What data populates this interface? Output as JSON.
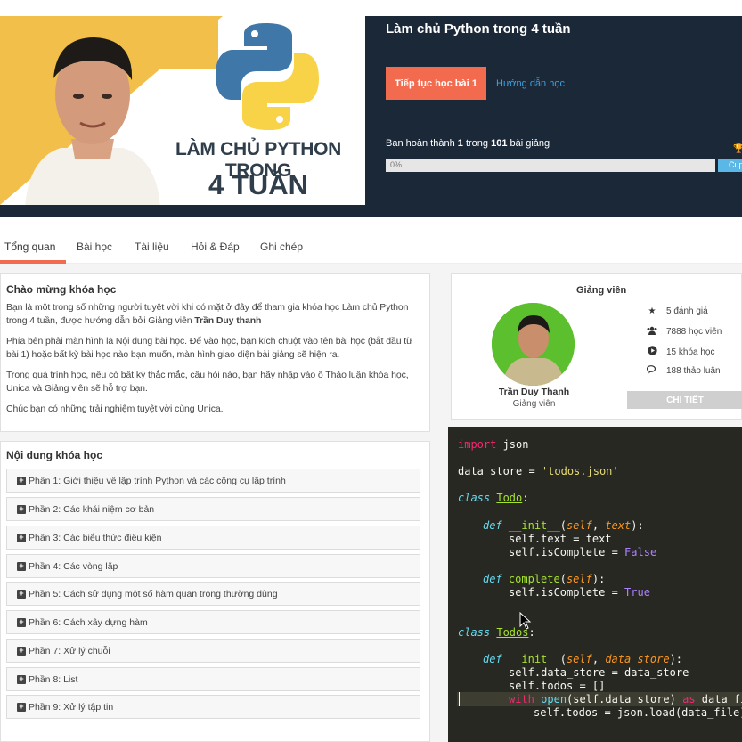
{
  "header": {
    "thumbnail": {
      "line1": "LÀM CHỦ PYTHON TRONG",
      "line2": "4 TUẦN"
    },
    "course_title": "Làm chủ Python trong 4 tuần",
    "continue_label": "Tiếp tục học bài 1",
    "guide_label": "Hướng dẫn học",
    "progress": {
      "prefix": "Bạn hoàn thành",
      "completed": "1",
      "middle": "trong",
      "total": "101",
      "suffix": "bài giảng",
      "percent_label": "0%",
      "fraction": 0
    },
    "cup_label": "Cup",
    "accent_color": "#f26b4f"
  },
  "tabs": [
    {
      "label": "Tổng quan",
      "active": true
    },
    {
      "label": "Bài học"
    },
    {
      "label": "Tài liệu"
    },
    {
      "label": "Hỏi & Đáp"
    },
    {
      "label": "Ghi chép"
    }
  ],
  "welcome": {
    "title": "Chào mừng khóa học",
    "p1_text": "Bạn là một trong số những người tuyệt vời khi có mặt ở đây để tham gia khóa học Làm chủ Python trong 4 tuần, được hướng dẫn bởi Giảng viên",
    "p1_name": "Trần Duy thanh",
    "p2": "Phía bên phải màn hình là Nội dung bài học. Để vào học, bạn kích chuột vào tên bài học (bắt đầu từ bài 1) hoặc bất kỳ bài học nào bạn muốn, màn hình giao diện bài giảng sẽ hiện ra.",
    "p3": "Trong quá trình học, nếu có bất kỳ thắc mắc, câu hỏi nào, bạn hãy nhập vào ô Thảo luận khóa học, Unica và Giảng viên sẽ hỗ trợ bạn.",
    "p4": "Chúc bạn có những trải nghiệm tuyệt vời cùng Unica."
  },
  "contents": {
    "title": "Nội dung khóa học",
    "sections": [
      "Phần 1: Giới thiệu về lập trình Python và các công cụ lập trình",
      "Phần 2: Các khái niệm cơ bản",
      "Phần 3: Các biểu thức điều kiện",
      "Phần 4: Các vòng lặp",
      "Phần 5: Cách sử dụng một số hàm quan trọng thường dùng",
      "Phần 6: Cách xây dựng hàm",
      "Phần 7: Xử lý chuỗi",
      "Phần 8: List",
      "Phần 9: Xử lý tập tin"
    ]
  },
  "instructor": {
    "title": "Giảng viên",
    "name": "Trần Duy Thanh",
    "role": "Giảng viên",
    "stats": [
      {
        "icon": "star-icon",
        "label": "5 đánh giá"
      },
      {
        "icon": "users-icon",
        "label": "7888 học viên"
      },
      {
        "icon": "play-circle-icon",
        "label": "15 khóa học"
      },
      {
        "icon": "comments-icon",
        "label": "188 thảo luận"
      }
    ],
    "detail_label": "CHI TIẾT"
  },
  "code": {
    "l1_kw": "import",
    "l1_rest": " json",
    "l2_a": "data_store = ",
    "l2_str": "'todos.json'",
    "l3_kw": "class",
    "l3_name": "Todo",
    "l3_end": ":",
    "l4_kw": "def",
    "l4_fn": "__init__",
    "l4_a": "(",
    "l4_self": "self",
    "l4_b": ", ",
    "l4_arg": "text",
    "l4_c": "):",
    "l5": "self.text = text",
    "l6_a": "self.isComplete = ",
    "l6_cst": "False",
    "l7_kw": "def",
    "l7_fn": "complete",
    "l7_a": "(",
    "l7_self": "self",
    "l7_b": "):",
    "l8_a": "self.isComplete = ",
    "l8_cst": "True",
    "l9_kw": "class",
    "l9_name": "Todos",
    "l9_end": ":",
    "l10_kw": "def",
    "l10_fn": "__init__",
    "l10_a": "(",
    "l10_self": "self",
    "l10_b": ", ",
    "l10_arg": "data_store",
    "l10_c": "):",
    "l11": "self.data_store = data_store",
    "l12": "self.todos = []",
    "l13_kw": "with",
    "l13_fn": "open",
    "l13_a": "(self.data_store) ",
    "l13_as": "as",
    "l13_b": " data_fi",
    "l14": "self.todos = json.load(data_file)"
  }
}
